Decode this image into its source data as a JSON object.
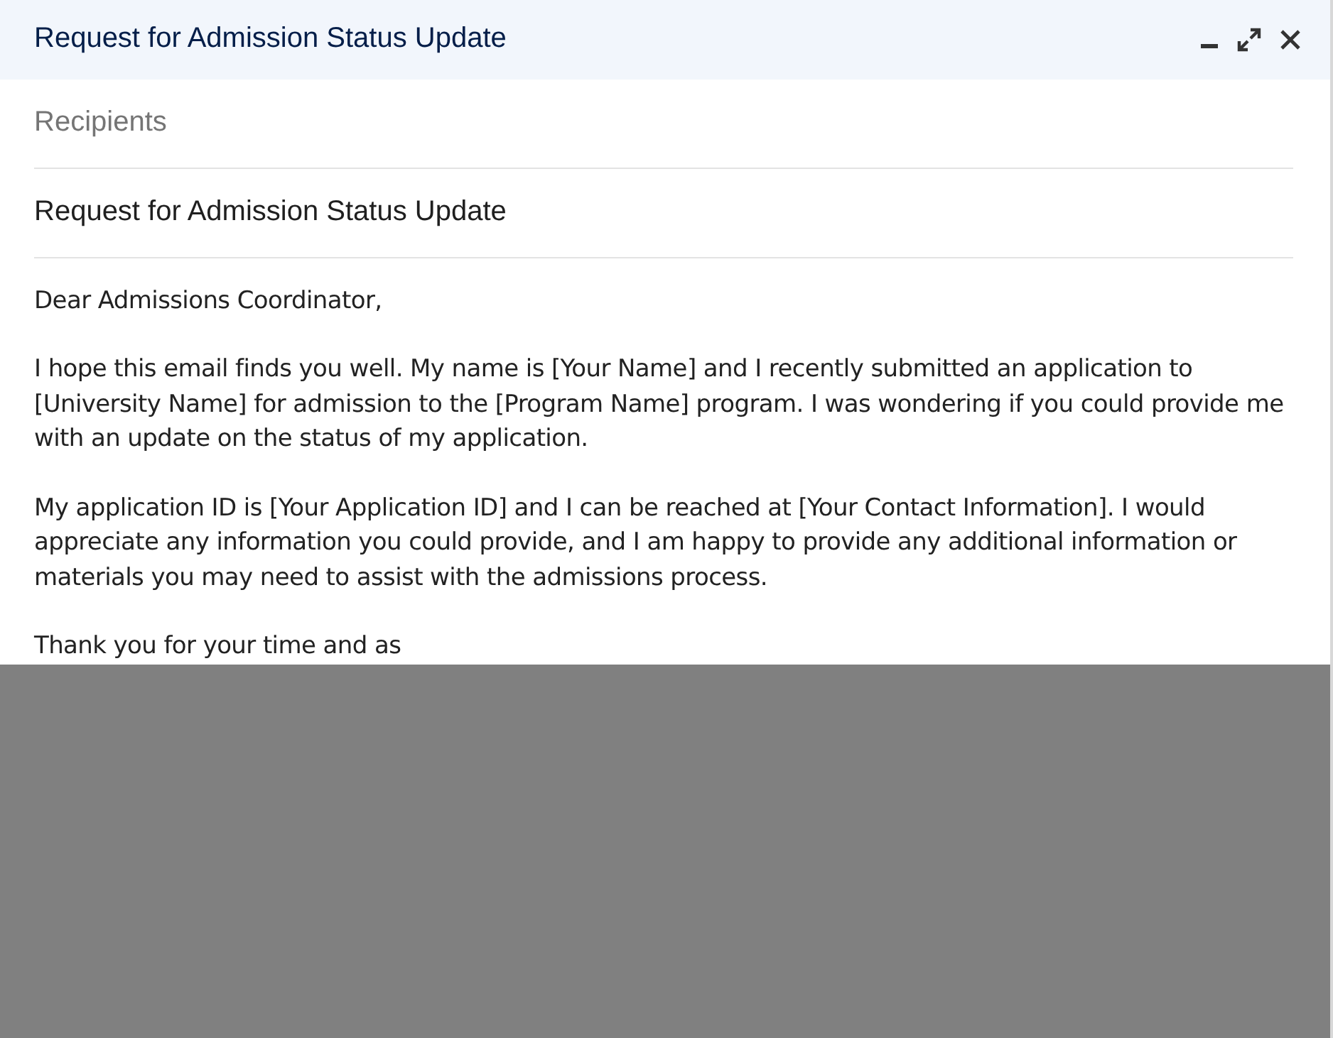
{
  "window": {
    "title": "Request for Admission Status Update"
  },
  "recipients": {
    "placeholder": "Recipients"
  },
  "subject": {
    "value": "Request for Admission Status Update"
  },
  "body": [
    "Dear Admissions Coordinator,",
    "I hope this email finds you well. My name is [Your Name] and I recently submitted an application to [University Name] for admission to the [Program Name] program. I was wondering if you could provide me with an update on the status of my application.",
    "My application ID is [Your Application ID] and I can be reached at [Your Contact Information]. I would appreciate any information you could provide, and I am happy to provide any additional information or materials you may need to assist with the admissions process.",
    "Thank you for your time and as"
  ]
}
